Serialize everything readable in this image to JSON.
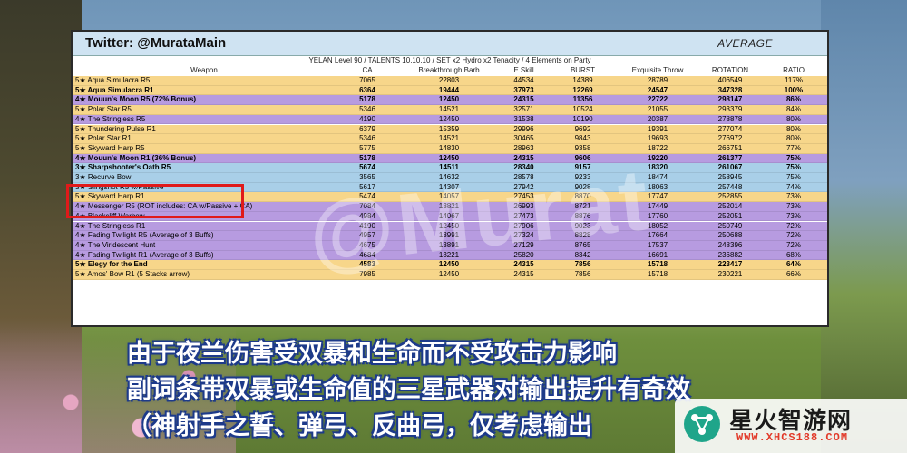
{
  "header": {
    "title": "Twitter: @MurataMain",
    "mode": "AVERAGE"
  },
  "subtitle": "YELAN Level 90 / TALENTS 10,10,10 / SET x2 Hydro x2 Tenacity / 4 Elements on Party",
  "columns": [
    "Weapon",
    "CA",
    "Breakthrough Barb",
    "E Skill",
    "BURST",
    "Exquisite Throw",
    "ROTATION",
    "RATIO"
  ],
  "rows": [
    {
      "w": "5★ Aqua Simulacra R5",
      "v": [
        "7065",
        "22803",
        "44534",
        "14389",
        "28789",
        "406549",
        "117%"
      ],
      "bg": "#f7d68a",
      "bold": false
    },
    {
      "w": "5★ Aqua Simulacra R1",
      "v": [
        "6364",
        "19444",
        "37973",
        "12269",
        "24547",
        "347328",
        "100%"
      ],
      "bg": "#f7d68a",
      "bold": true
    },
    {
      "w": "4★ Mouun's Moon R5 (72% Bonus)",
      "v": [
        "5178",
        "12450",
        "24315",
        "11356",
        "22722",
        "298147",
        "86%"
      ],
      "bg": "#b79be0",
      "bold": true
    },
    {
      "w": "5★ Polar Star R5",
      "v": [
        "5346",
        "14521",
        "32571",
        "10524",
        "21055",
        "293379",
        "84%"
      ],
      "bg": "#f7d68a",
      "bold": false
    },
    {
      "w": "4★ The Stringless R5",
      "v": [
        "4190",
        "12450",
        "31538",
        "10190",
        "20387",
        "278878",
        "80%"
      ],
      "bg": "#b79be0",
      "bold": false
    },
    {
      "w": "5★ Thundering Pulse R1",
      "v": [
        "6379",
        "15359",
        "29996",
        "9692",
        "19391",
        "277074",
        "80%"
      ],
      "bg": "#f7d68a",
      "bold": false
    },
    {
      "w": "5★ Polar Star R1",
      "v": [
        "5346",
        "14521",
        "30465",
        "9843",
        "19693",
        "276972",
        "80%"
      ],
      "bg": "#f7d68a",
      "bold": false
    },
    {
      "w": "5★ Skyward Harp R5",
      "v": [
        "5775",
        "14830",
        "28963",
        "9358",
        "18722",
        "266751",
        "77%"
      ],
      "bg": "#f7d68a",
      "bold": false
    },
    {
      "w": "4★ Mouun's Moon R1 (36% Bonus)",
      "v": [
        "5178",
        "12450",
        "24315",
        "9606",
        "19220",
        "261377",
        "75%"
      ],
      "bg": "#b79be0",
      "bold": true
    },
    {
      "w": "3★ Sharpshooter's Oath R5",
      "v": [
        "5674",
        "14511",
        "28340",
        "9157",
        "18320",
        "261067",
        "75%"
      ],
      "bg": "#a9cfe8",
      "bold": true
    },
    {
      "w": "3★ Recurve Bow",
      "v": [
        "3565",
        "14632",
        "28578",
        "9233",
        "18474",
        "258945",
        "75%"
      ],
      "bg": "#a9cfe8",
      "bold": false
    },
    {
      "w": "3★ Slingshot R5 w/Passive",
      "v": [
        "5617",
        "14307",
        "27942",
        "9028",
        "18063",
        "257448",
        "74%"
      ],
      "bg": "#a9cfe8",
      "bold": false
    },
    {
      "w": "5★ Skyward Harp R1",
      "v": [
        "5474",
        "14057",
        "27453",
        "8870",
        "17747",
        "252855",
        "73%"
      ],
      "bg": "#f7d68a",
      "bold": false
    },
    {
      "w": "4★ Messenger R5 (ROT includes: CA w/Passive + CA)",
      "v": [
        "7084",
        "13821",
        "26993",
        "8721",
        "17449",
        "252014",
        "73%"
      ],
      "bg": "#b79be0",
      "bold": false
    },
    {
      "w": "4★ Blackcliff Warbow",
      "v": [
        "4984",
        "14067",
        "27473",
        "8876",
        "17760",
        "252051",
        "73%"
      ],
      "bg": "#b79be0",
      "bold": false
    },
    {
      "w": "4★ The Stringless R1",
      "v": [
        "4190",
        "12450",
        "27906",
        "9023",
        "18052",
        "250749",
        "72%"
      ],
      "bg": "#b79be0",
      "bold": false
    },
    {
      "w": "4★ Fading Twilight R5 (Average of 3 Buffs)",
      "v": [
        "4957",
        "13991",
        "27324",
        "8828",
        "17664",
        "250688",
        "72%"
      ],
      "bg": "#b79be0",
      "bold": false
    },
    {
      "w": "4★ The Viridescent Hunt",
      "v": [
        "4675",
        "13891",
        "27129",
        "8765",
        "17537",
        "248396",
        "72%"
      ],
      "bg": "#b79be0",
      "bold": false
    },
    {
      "w": "4★ Fading Twilight R1 (Average of 3 Buffs)",
      "v": [
        "4684",
        "13221",
        "25820",
        "8342",
        "16691",
        "236882",
        "68%"
      ],
      "bg": "#b79be0",
      "bold": false
    },
    {
      "w": "5★ Elegy for the End",
      "v": [
        "4583",
        "12450",
        "24315",
        "7856",
        "15718",
        "223417",
        "64%"
      ],
      "bg": "#f7d68a",
      "bold": true
    },
    {
      "w": "5★ Amos' Bow R1 (5 Stacks arrow)",
      "v": [
        "7985",
        "12450",
        "24315",
        "7856",
        "15718",
        "230221",
        "66%"
      ],
      "bg": "#f7d68a",
      "bold": false
    }
  ],
  "watermark": "@Murat",
  "caption": {
    "line1": "由于夜兰伤害受双暴和生命而不受攻击力影响",
    "line2": "副词条带双暴或生命值的三星武器对输出提升有奇效",
    "line3": "（神射手之誓、弹弓、反曲弓，仅考虑输出"
  },
  "logo": {
    "name": "星火智游网",
    "url": "WWW.XHCS188.COM"
  },
  "colors": {
    "gold": "#f7d68a",
    "purple": "#b79be0",
    "blue": "#a9cfe8",
    "highlight": "#e01a1a",
    "caption_outline": "#1d3a8a"
  }
}
